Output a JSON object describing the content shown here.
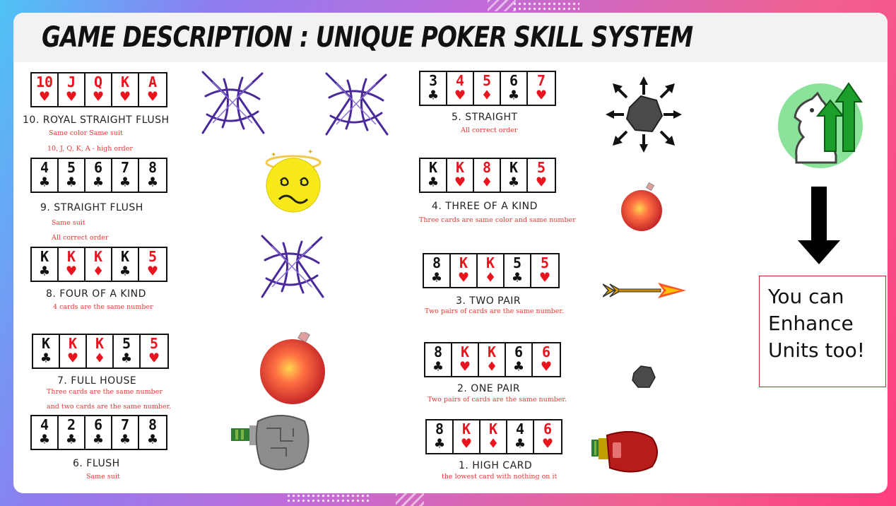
{
  "title": "Game Description : Unique Poker Skill System",
  "colors": {
    "red_suit": "#e8141e",
    "black_suit": "#111111",
    "desc_text": "#e53935",
    "box_border": "#c62828"
  },
  "hands": [
    {
      "id": "royal",
      "name": "10. ROYAL STRAIGHT FLUSH",
      "desc": [
        "Same color  Same suit",
        "10, J, Q, K, A - high order"
      ],
      "cards": [
        {
          "r": "10",
          "s": "♥",
          "c": "red"
        },
        {
          "r": "J",
          "s": "♥",
          "c": "red"
        },
        {
          "r": "Q",
          "s": "♥",
          "c": "red"
        },
        {
          "r": "K",
          "s": "♥",
          "c": "red"
        },
        {
          "r": "A",
          "s": "♥",
          "c": "red"
        }
      ],
      "skill_icon": "purple-vortex-icon"
    },
    {
      "id": "sflush",
      "name": "9. STRAIGHT FLUSH",
      "desc": [
        "Same  suit",
        "All correct order"
      ],
      "cards": [
        {
          "r": "4",
          "s": "♣",
          "c": "blk"
        },
        {
          "r": "5",
          "s": "♣",
          "c": "blk"
        },
        {
          "r": "6",
          "s": "♣",
          "c": "blk"
        },
        {
          "r": "7",
          "s": "♣",
          "c": "blk"
        },
        {
          "r": "8",
          "s": "♣",
          "c": "blk"
        }
      ],
      "skill_icon": "dizzy-face-icon"
    },
    {
      "id": "four",
      "name": "8. FOUR OF A KIND",
      "desc": [
        "4 cards are the same number"
      ],
      "cards": [
        {
          "r": "K",
          "s": "♣",
          "c": "blk"
        },
        {
          "r": "K",
          "s": "♥",
          "c": "red"
        },
        {
          "r": "K",
          "s": "♦",
          "c": "red"
        },
        {
          "r": "K",
          "s": "♣",
          "c": "blk"
        },
        {
          "r": "5",
          "s": "♥",
          "c": "red"
        }
      ],
      "skill_icon": "purple-vortex-icon"
    },
    {
      "id": "full",
      "name": "7. FULL HOUSE",
      "desc": [
        "Three cards are the same number",
        "and two cards are the same number."
      ],
      "cards": [
        {
          "r": "K",
          "s": "♣",
          "c": "blk"
        },
        {
          "r": "K",
          "s": "♥",
          "c": "red"
        },
        {
          "r": "K",
          "s": "♦",
          "c": "red"
        },
        {
          "r": "5",
          "s": "♣",
          "c": "blk"
        },
        {
          "r": "5",
          "s": "♥",
          "c": "red"
        }
      ],
      "skill_icon": "bomb-icon"
    },
    {
      "id": "flush",
      "name": "6. FLUSH",
      "desc": [
        "Same suit"
      ],
      "cards": [
        {
          "r": "4",
          "s": "♣",
          "c": "blk"
        },
        {
          "r": "2",
          "s": "♣",
          "c": "blk"
        },
        {
          "r": "6",
          "s": "♣",
          "c": "blk"
        },
        {
          "r": "7",
          "s": "♣",
          "c": "blk"
        },
        {
          "r": "8",
          "s": "♣",
          "c": "blk"
        }
      ],
      "skill_icon": "stone-fist-icon"
    },
    {
      "id": "straight",
      "name": "5. STRAIGHT",
      "desc": [
        "All correct order"
      ],
      "cards": [
        {
          "r": "3",
          "s": "♣",
          "c": "blk"
        },
        {
          "r": "4",
          "s": "♥",
          "c": "red"
        },
        {
          "r": "5",
          "s": "♦",
          "c": "red"
        },
        {
          "r": "6",
          "s": "♣",
          "c": "blk"
        },
        {
          "r": "7",
          "s": "♥",
          "c": "red"
        }
      ],
      "skill_icon": "rock-burst-icon"
    },
    {
      "id": "three",
      "name": "4. THREE OF A KIND",
      "desc": [
        "Three cards are same color and same number"
      ],
      "cards": [
        {
          "r": "K",
          "s": "♣",
          "c": "blk"
        },
        {
          "r": "K",
          "s": "♥",
          "c": "red"
        },
        {
          "r": "8",
          "s": "♦",
          "c": "red"
        },
        {
          "r": "K",
          "s": "♣",
          "c": "blk"
        },
        {
          "r": "5",
          "s": "♥",
          "c": "red"
        }
      ],
      "skill_icon": "small-bomb-icon"
    },
    {
      "id": "twopair",
      "name": "3. TWO PAIR",
      "desc": [
        "Two pairs of cards are the same number."
      ],
      "cards": [
        {
          "r": "8",
          "s": "♣",
          "c": "blk"
        },
        {
          "r": "K",
          "s": "♥",
          "c": "red"
        },
        {
          "r": "K",
          "s": "♦",
          "c": "red"
        },
        {
          "r": "5",
          "s": "♣",
          "c": "blk"
        },
        {
          "r": "5",
          "s": "♥",
          "c": "red"
        }
      ],
      "skill_icon": "fire-arrow-icon"
    },
    {
      "id": "onepair",
      "name": "2. ONE PAIR",
      "desc": [
        "Two pairs of cards are the same number."
      ],
      "cards": [
        {
          "r": "8",
          "s": "♣",
          "c": "blk"
        },
        {
          "r": "K",
          "s": "♥",
          "c": "red"
        },
        {
          "r": "K",
          "s": "♦",
          "c": "red"
        },
        {
          "r": "6",
          "s": "♣",
          "c": "blk"
        },
        {
          "r": "6",
          "s": "♥",
          "c": "red"
        }
      ],
      "skill_icon": "small-rock-icon"
    },
    {
      "id": "high",
      "name": "1. HIGH CARD",
      "desc": [
        "the lowest card with nothing on it"
      ],
      "cards": [
        {
          "r": "8",
          "s": "♣",
          "c": "blk"
        },
        {
          "r": "K",
          "s": "♥",
          "c": "red"
        },
        {
          "r": "K",
          "s": "♦",
          "c": "red"
        },
        {
          "r": "4",
          "s": "♣",
          "c": "blk"
        },
        {
          "r": "6",
          "s": "♥",
          "c": "red"
        }
      ],
      "skill_icon": "boxing-glove-icon"
    }
  ],
  "enhance": {
    "text_line1": "You can",
    "text_line2": "Enhance",
    "text_line3": "Units too!",
    "icon": "knight-upgrade-icon",
    "arrow_icon": "down-arrow-icon"
  }
}
